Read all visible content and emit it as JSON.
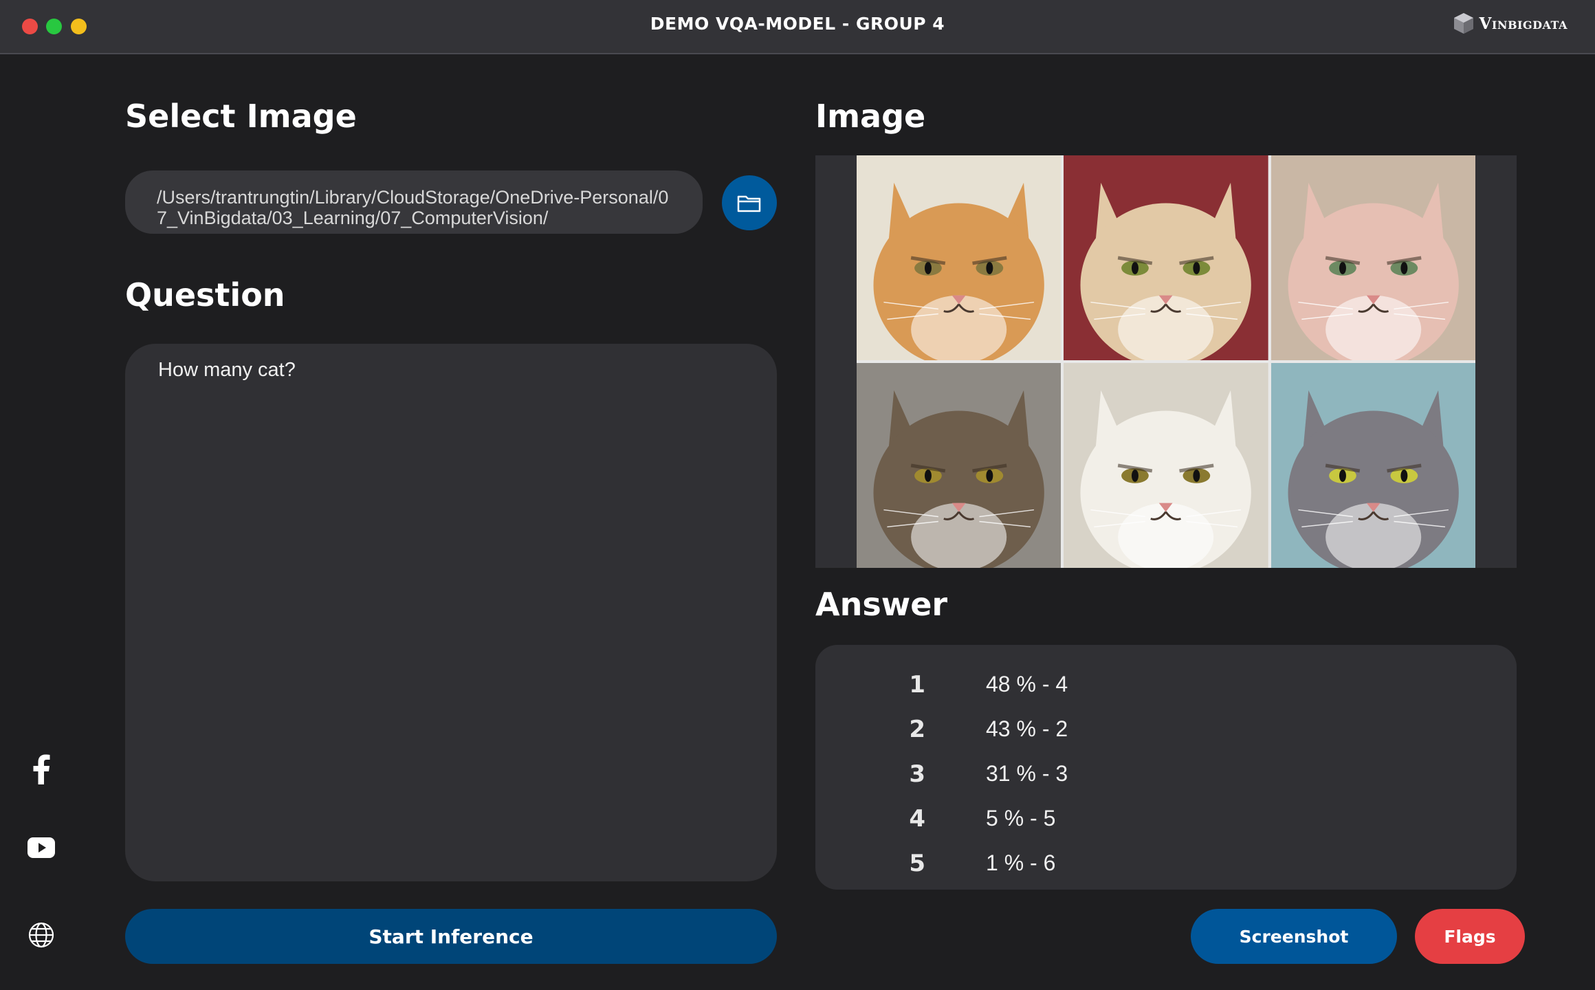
{
  "window": {
    "title": "DEMO VQA-MODEL - GROUP 4",
    "brand": "Vinbigdata",
    "controls": [
      "close",
      "minimize",
      "maximize"
    ]
  },
  "select_image": {
    "heading": "Select Image",
    "path_value": "/Users/trantrungtin/Library/CloudStorage/OneDrive-Personal/07_VinBigdata/03_Learning/07_ComputerVision/",
    "browse_icon": "folder-icon"
  },
  "question": {
    "heading": "Question",
    "value": "How many cat?"
  },
  "actions": {
    "start_label": "Start Inference",
    "screenshot_label": "Screenshot",
    "flags_label": "Flags"
  },
  "image": {
    "heading": "Image",
    "grid": [
      {
        "subject": "orange tabby cat",
        "bg": "#e7e1d3",
        "fur": "#d99a55",
        "eyes": "#8a7a40"
      },
      {
        "subject": "cream grumpy cat",
        "bg": "#8a2f34",
        "fur": "#e2c9a6",
        "eyes": "#7c8b3a"
      },
      {
        "subject": "hairless sphynx cat",
        "bg": "#c9b7a5",
        "fur": "#e6bfb3",
        "eyes": "#6d8a62"
      },
      {
        "subject": "brown tabby cat",
        "bg": "#8e8a84",
        "fur": "#6e5e4c",
        "eyes": "#a08a30"
      },
      {
        "subject": "white persian cat",
        "bg": "#d8d3c8",
        "fur": "#f2efe8",
        "eyes": "#8a7a30"
      },
      {
        "subject": "grey and white cat",
        "bg": "#8fb6be",
        "fur": "#7d7b82",
        "eyes": "#c8c840"
      }
    ]
  },
  "answer": {
    "heading": "Answer",
    "rows": [
      {
        "rank": "1",
        "value": "48 % - 4"
      },
      {
        "rank": "2",
        "value": "43 % - 2"
      },
      {
        "rank": "3",
        "value": "31 % - 3"
      },
      {
        "rank": "4",
        "value": "5 % - 5"
      },
      {
        "rank": "5",
        "value": "1 % - 6"
      }
    ]
  },
  "social": [
    "facebook-icon",
    "youtube-icon",
    "globe-icon"
  ],
  "colors": {
    "background": "#1e1e20",
    "panel": "#303034",
    "primary": "#004578",
    "accent_blue": "#005699",
    "danger": "#e53f43"
  }
}
